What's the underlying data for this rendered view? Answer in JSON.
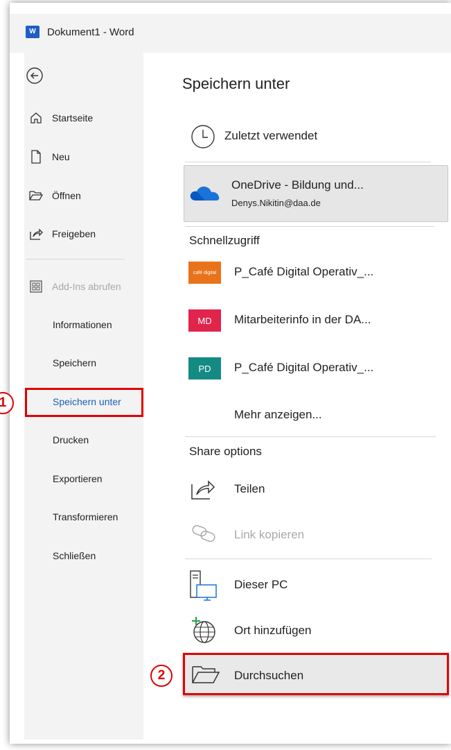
{
  "window": {
    "title": "Dokument1 - Word",
    "app_logo": "W"
  },
  "sidebar": {
    "items": [
      {
        "label": "Startseite",
        "icon": "home-icon"
      },
      {
        "label": "Neu",
        "icon": "new-document-icon"
      },
      {
        "label": "Öffnen",
        "icon": "open-folder-icon"
      },
      {
        "label": "Freigeben",
        "icon": "share-icon"
      },
      {
        "label": "Add-Ins abrufen",
        "icon": "add-ins-icon",
        "disabled": true
      },
      {
        "label": "Informationen"
      },
      {
        "label": "Speichern"
      },
      {
        "label": "Speichern unter",
        "selected": true
      },
      {
        "label": "Drucken"
      },
      {
        "label": "Exportieren"
      },
      {
        "label": "Transformieren"
      },
      {
        "label": "Schließen"
      }
    ]
  },
  "annotations": {
    "badge1": "1",
    "badge2": "2"
  },
  "main": {
    "title": "Speichern unter",
    "recent": {
      "label": "Zuletzt verwendet",
      "icon": "clock-icon"
    },
    "onedrive": {
      "label": "OneDrive - Bildung und...",
      "account": "Denys.Nikitin@daa.de",
      "icon": "onedrive-cloud-icon"
    },
    "quick_access": {
      "heading": "Schnellzugriff",
      "items": [
        {
          "label": "P_Café Digital Operativ_...",
          "tile_text": "café digital",
          "tile_color": "#e8731a"
        },
        {
          "label": "Mitarbeiterinfo in der DA...",
          "tile_text": "MD",
          "tile_color": "#e0244c"
        },
        {
          "label": "P_Café Digital Operativ_...",
          "tile_text": "PD",
          "tile_color": "#148a83"
        }
      ],
      "more": "Mehr anzeigen..."
    },
    "share": {
      "heading": "Share options",
      "share_label": "Teilen",
      "link_label": "Link kopieren"
    },
    "locations": {
      "this_pc": "Dieser PC",
      "add_place": "Ort hinzufügen",
      "browse": "Durchsuchen"
    }
  },
  "colors": {
    "highlight": "#e00000",
    "selected_text": "#1a5fb4",
    "sidebar_bg": "#f3f3f3"
  }
}
